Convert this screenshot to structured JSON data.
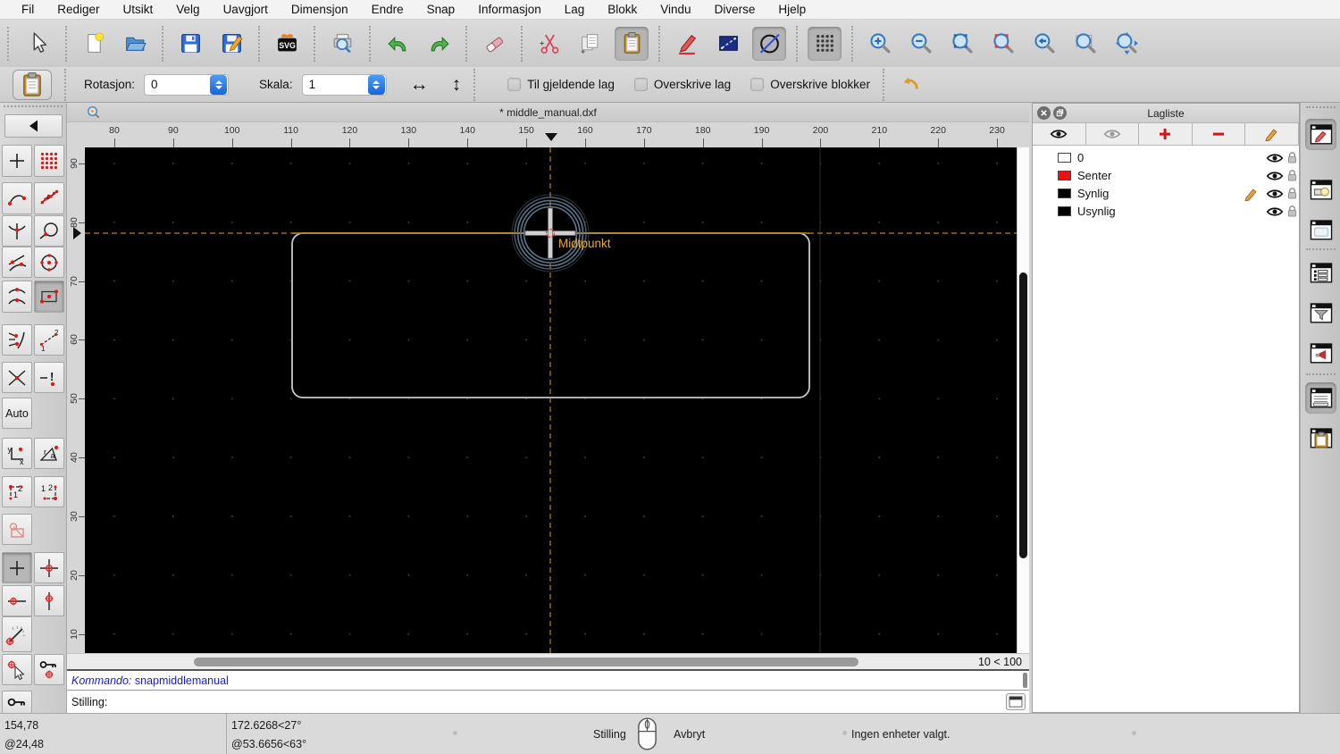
{
  "menu": {
    "items": [
      "Fil",
      "Rediger",
      "Utsikt",
      "Velg",
      "Uavgjort",
      "Dimensjon",
      "Endre",
      "Snap",
      "Informasjon",
      "Lag",
      "Blokk",
      "Vindu",
      "Diverse",
      "Hjelp"
    ]
  },
  "toolbar": {
    "groups": [
      [
        "cursor-arrow"
      ],
      [
        "new-file",
        "open-file"
      ],
      [
        "save-file",
        "save-file-as"
      ],
      [
        "svg-export"
      ],
      [
        "print-preview"
      ],
      [
        "undo",
        "redo"
      ],
      [
        "eraser"
      ],
      [
        "cut",
        "copy",
        "paste"
      ],
      [
        "draw-pencil",
        "rectangle-tool",
        "ellipse-tool"
      ],
      [
        "grid-toggle"
      ],
      [
        "zoom-in",
        "zoom-out",
        "zoom-auto",
        "zoom-previous",
        "zoom-back",
        "zoom-window",
        "zoom-pan"
      ]
    ],
    "active": [
      "paste",
      "ellipse-tool",
      "grid-toggle"
    ]
  },
  "options": {
    "rotation_label": "Rotasjon:",
    "rotation_value": "0",
    "scale_label": "Skala:",
    "scale_value": "1",
    "checkboxes": [
      "Til gjeldende lag",
      "Overskrive lag",
      "Overskrive blokker"
    ]
  },
  "palette": {
    "auto_label": "Auto",
    "selected": [
      "snap-middle-manual",
      "restrict-nothing"
    ],
    "tools": [
      "back",
      "snap-free",
      "snap-grid",
      "snap-endpoints",
      "snap-on-entity",
      "snap-intersection-auto",
      "snap-closest",
      "snap-tangent",
      "snap-center",
      "snap-middle",
      "snap-middle-manual",
      "snap-perpendicular",
      "snap-distance",
      "snap-intersection",
      "snap-intersection-manual",
      "snap-auto",
      "snap-coordinate",
      "snap-coordinate-polar",
      "snap-relative",
      "snap-relative-polar",
      "snap-restrict-status",
      "restrict-nothing",
      "restrict-orthogonal",
      "restrict-horizontal",
      "restrict-vertical",
      "restrict-angle",
      "set-relative-zero",
      "lock-relative-zero",
      "lock-zero"
    ]
  },
  "document": {
    "title": "* middle_manual.dxf",
    "h_ruler": [
      "80",
      "90",
      "100",
      "110",
      "120",
      "130",
      "140",
      "150",
      "160",
      "170",
      "180",
      "190",
      "200",
      "210",
      "220",
      "230"
    ],
    "v_ruler": [
      "90",
      "80",
      "70",
      "60",
      "50",
      "40",
      "30",
      "20",
      "10"
    ],
    "snap_label": "Midtpunkt",
    "zoom_range": "10 < 100"
  },
  "command": {
    "history_label": "Kommando:",
    "history_value": "snapmiddlemanual",
    "prompt_label": "Stilling:"
  },
  "status": {
    "coord_abs": "154,78",
    "coord_rel": "@24,48",
    "polar_abs": "172.6268<27°",
    "polar_rel": "@53.6656<63°",
    "mouse_left": "Stilling",
    "mouse_right": "Avbryt",
    "selection_info": "Ingen enheter valgt."
  },
  "layer_panel": {
    "title": "Lagliste",
    "layers": [
      {
        "name": "0",
        "color": "#ffffff",
        "editing": false
      },
      {
        "name": "Senter",
        "color": "#ee1111",
        "editing": false
      },
      {
        "name": "Synlig",
        "color": "#000000",
        "editing": true
      },
      {
        "name": "Usynlig",
        "color": "#000000",
        "editing": false
      }
    ]
  },
  "dock": {
    "panels": [
      "layer-list",
      "block-list",
      "library-browser",
      "property-editor",
      "selection-filter",
      "output",
      "command-history",
      "clipboard"
    ],
    "active": [
      "layer-list",
      "command-history"
    ]
  },
  "colors": {
    "crosshair": "#b5861e",
    "snap_label": "#e8a838",
    "command_text": "#1a1acc",
    "entity": "#c9c9c9",
    "snap_ring": "#5e7689",
    "layer_red": "#ee1111"
  }
}
